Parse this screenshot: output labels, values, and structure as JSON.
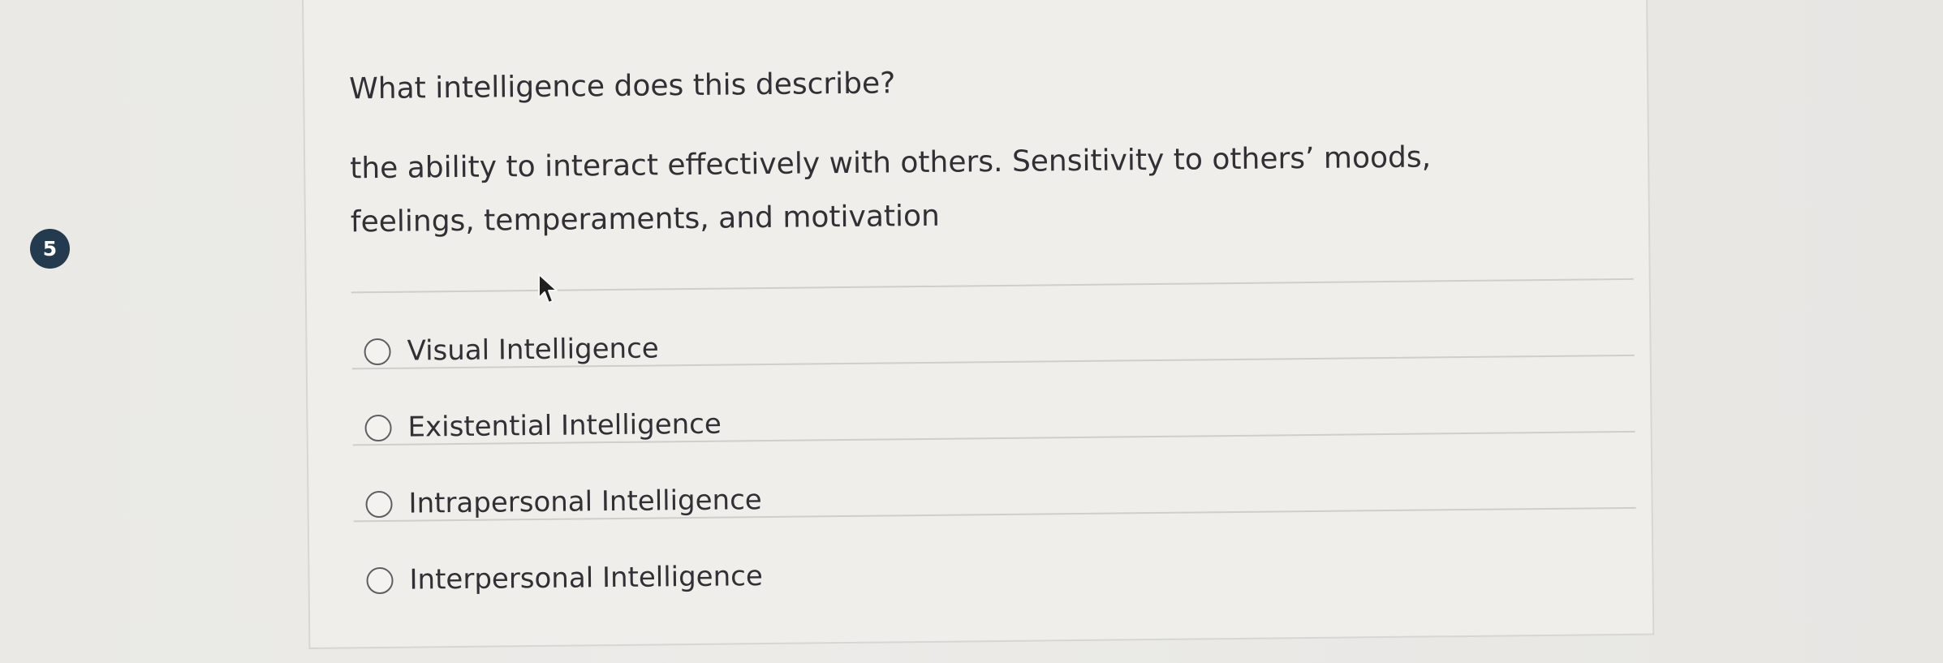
{
  "question": {
    "number": "5",
    "title": "What intelligence does this describe?",
    "description": "the ability to interact effectively with others. Sensitivity to others’ moods, feelings, temperaments, and motivation"
  },
  "options": [
    {
      "label": "Visual Intelligence",
      "selected": false
    },
    {
      "label": "Existential Intelligence",
      "selected": false
    },
    {
      "label": "Intrapersonal Intelligence",
      "selected": false
    },
    {
      "label": "Interpersonal Intelligence",
      "selected": false
    }
  ],
  "colors": {
    "background": "#e9e8e5",
    "card": "#efeeeb",
    "badge": "#243a4e",
    "text": "#303035"
  },
  "icons": {
    "cursor": "mouse-pointer-icon",
    "radio": "radio-button-icon"
  }
}
